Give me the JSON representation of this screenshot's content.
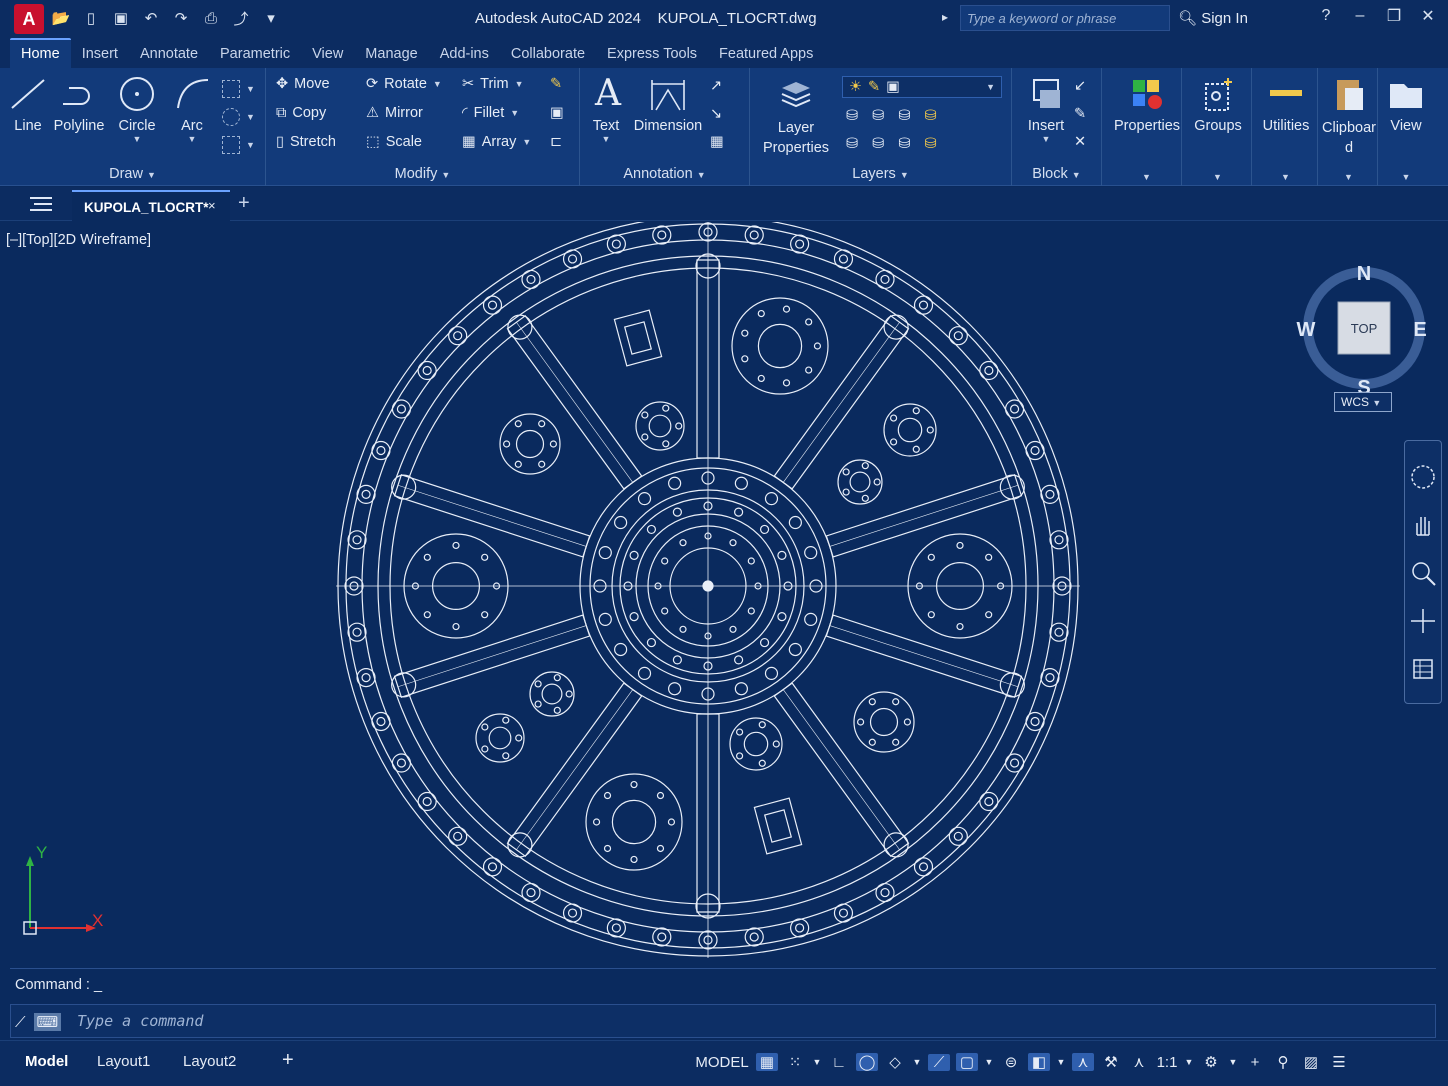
{
  "titlebar": {
    "logo": "A",
    "app_title": "Autodesk AutoCAD 2024",
    "file_title": "KUPOLA_TLOCRT.dwg",
    "search_placeholder": "Type a keyword or phrase",
    "sign_in": "Sign In"
  },
  "menu": {
    "tabs": [
      "Home",
      "Insert",
      "Annotate",
      "Parametric",
      "View",
      "Manage",
      "Add-ins",
      "Collaborate",
      "Express Tools",
      "Featured Apps"
    ],
    "active": "Home"
  },
  "ribbon": {
    "draw": {
      "title": "Draw",
      "line": "Line",
      "polyline": "Polyline",
      "circle": "Circle",
      "arc": "Arc"
    },
    "modify": {
      "title": "Modify",
      "move": "Move",
      "rotate": "Rotate",
      "trim": "Trim",
      "copy": "Copy",
      "mirror": "Mirror",
      "fillet": "Fillet",
      "stretch": "Stretch",
      "scale": "Scale",
      "array": "Array"
    },
    "annotation": {
      "title": "Annotation",
      "text": "Text",
      "dimension": "Dimension"
    },
    "layers": {
      "title": "Layers",
      "layer_properties": "Layer Properties"
    },
    "block": {
      "title": "Block",
      "insert": "Insert"
    },
    "properties": "Properties",
    "groups": "Groups",
    "utilities": "Utilities",
    "clipboard": "Clipboard",
    "view": "View"
  },
  "filetab": {
    "name": "KUPOLA_TLOCRT*",
    "close": "×",
    "add": "+"
  },
  "viewport": {
    "label": "[–][Top][2D Wireframe]",
    "compass": {
      "n": "N",
      "s": "S",
      "e": "E",
      "w": "W",
      "cube": "TOP"
    },
    "wcs": "WCS",
    "ucs_x": "X",
    "ucs_y": "Y"
  },
  "command": {
    "history": "Command : _",
    "placeholder": "Type a command"
  },
  "statusbar": {
    "tabs": [
      "Model",
      "Layout1",
      "Layout2"
    ],
    "active": "Model",
    "add": "+",
    "model": "MODEL",
    "scale": "1:1"
  },
  "colors": {
    "background": "#0a2a5e",
    "ribbon": "#123a7a",
    "line_work": "#e8eef8",
    "ucs_x": "#e03131",
    "ucs_y": "#2fb344"
  }
}
